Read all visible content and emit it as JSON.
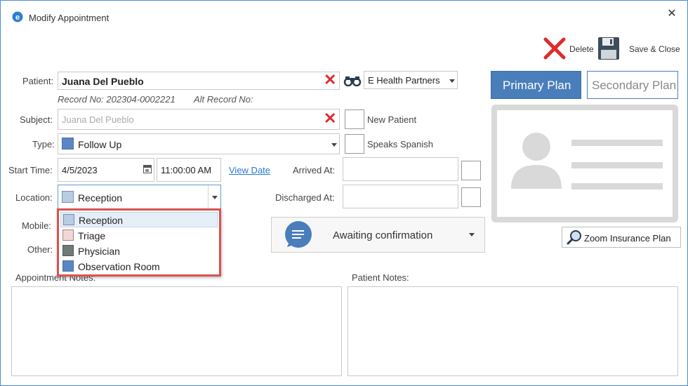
{
  "window": {
    "title": "Modify Appointment",
    "close_glyph": "✕"
  },
  "toolbar": {
    "delete_label": "Delete",
    "save_close_label": "Save & Close"
  },
  "patient": {
    "label": "Patient:",
    "value": "Juana Del Pueblo",
    "record_no": "Record No: 202304-0002221",
    "alt_record": "Alt Record No:",
    "practice": "E Health Partners"
  },
  "subject": {
    "label": "Subject:",
    "placeholder": "Juana Del Pueblo",
    "new_patient_label": "New Patient"
  },
  "type": {
    "label": "Type:",
    "value": "Follow Up",
    "color": "#5b86c5",
    "speaks_spanish_label": "Speaks Spanish"
  },
  "start": {
    "label": "Start Time:",
    "date": "4/5/2023",
    "time": "11:00:00 AM",
    "view_date_label": "View Date",
    "arrived_label": "Arrived At:"
  },
  "location": {
    "label": "Location:",
    "value": "Reception",
    "color": "#b8cce4",
    "discharged_label": "Discharged At:",
    "options": [
      {
        "label": "Reception",
        "color": "#b8cce4"
      },
      {
        "label": "Triage",
        "color": "#f2d7d7"
      },
      {
        "label": "Physician",
        "color": "#707a77"
      },
      {
        "label": "Observation Room",
        "color": "#5b86c5"
      }
    ]
  },
  "mobile": {
    "label": "Mobile:"
  },
  "other": {
    "label": "Other:"
  },
  "status": {
    "label": "Awaiting confirmation"
  },
  "plans": {
    "primary_label": "Primary Plan",
    "secondary_label": "Secondary Plan",
    "zoom_label": "Zoom Insurance Plan"
  },
  "notes": {
    "appointment_label": "Appointment Notes:",
    "patient_label": "Patient Notes:"
  },
  "colors": {
    "accent": "#4a7ebb",
    "danger": "#e02b2b",
    "highlight": "#d9534f",
    "link": "#2a7ad5"
  }
}
